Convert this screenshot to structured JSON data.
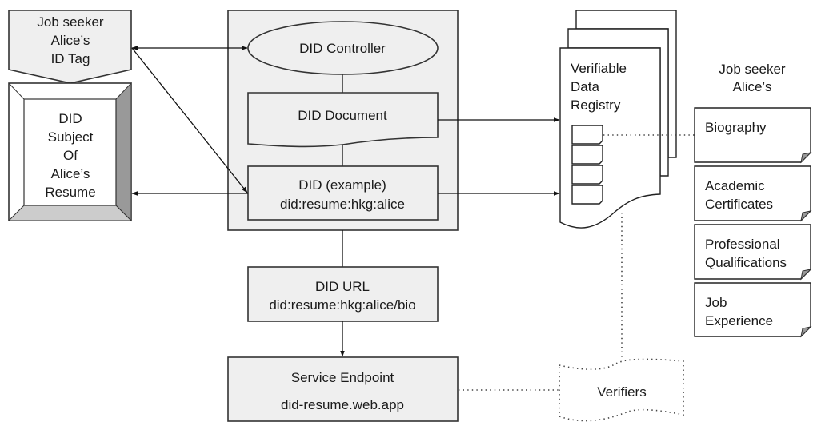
{
  "id_tag": {
    "lines": [
      "Job seeker",
      "Alice’s",
      "ID Tag"
    ]
  },
  "did_subject": {
    "lines": [
      "DID",
      "Subject",
      "Of",
      "Alice’s",
      "Resume"
    ]
  },
  "did_controller": {
    "label": "DID Controller"
  },
  "did_document": {
    "label": "DID Document"
  },
  "did_example": {
    "title": "DID (example)",
    "value": "did:resume:hkg:alice"
  },
  "did_url": {
    "title": "DID URL",
    "value": "did:resume:hkg:alice/bio"
  },
  "service_endpoint": {
    "title": "Service Endpoint",
    "value": "did-resume.web.app"
  },
  "registry": {
    "lines": [
      "Verifiable",
      "Data",
      "Registry"
    ]
  },
  "verifiers": {
    "label": "Verifiers"
  },
  "alice_records": {
    "heading": [
      "Job seeker",
      "Alice’s"
    ],
    "items": [
      {
        "lines": [
          "Biography"
        ]
      },
      {
        "lines": [
          "Academic",
          "Certificates"
        ]
      },
      {
        "lines": [
          "Professional",
          "Qualifications"
        ]
      },
      {
        "lines": [
          "Job",
          "Experience"
        ]
      }
    ]
  },
  "colors": {
    "container_fill": "#efefef",
    "bevel_dark": "#999999",
    "bevel_light": "#cccccc",
    "stroke": "#222222"
  }
}
